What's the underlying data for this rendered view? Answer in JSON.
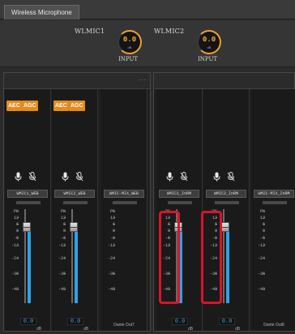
{
  "tabs": [
    {
      "label": "Wireless Microphone"
    }
  ],
  "inputs": [
    {
      "name": "WLMIC1",
      "value": "0.0",
      "unit": "dB",
      "label": "INPUT"
    },
    {
      "name": "WLMIC2",
      "value": "0.0",
      "unit": "dB",
      "label": "INPUT"
    }
  ],
  "menu_dots": "...",
  "aec_label": "AEC",
  "agc_label": "AGC",
  "scale_ticks": [
    "PK",
    "12",
    "6",
    "0",
    "-6",
    "-12",
    "-24",
    "-36",
    "-48"
  ],
  "db_unit": "dB",
  "channels": [
    {
      "name": "WMIC1_WEB",
      "value": "0.0",
      "has_buttons": true,
      "has_icons": true,
      "has_fader": true,
      "output": ""
    },
    {
      "name": "WMIC2_WEB",
      "value": "0.0",
      "has_buttons": true,
      "has_icons": true,
      "has_fader": true,
      "output": ""
    },
    {
      "name": "WMIC-MIX_WEB",
      "value": "",
      "has_buttons": false,
      "has_icons": false,
      "has_fader": false,
      "output": "Dante Out7"
    },
    {
      "name": "WMIC1_InRM",
      "value": "0.0",
      "has_buttons": false,
      "has_icons": true,
      "has_fader": true,
      "output": ""
    },
    {
      "name": "WMIC2_InRM",
      "value": "0.0",
      "has_buttons": false,
      "has_icons": true,
      "has_fader": true,
      "output": ""
    },
    {
      "name": "WMIC-MIX_InRM",
      "value": "",
      "has_buttons": false,
      "has_icons": false,
      "has_fader": false,
      "output": "Dante Out8"
    }
  ],
  "colors": {
    "accent": "#e58b1d",
    "meter": "#2ea3e6",
    "highlight": "#d9142b",
    "knob_value": "#ffb030"
  },
  "icons": {
    "mic": "microphone-icon",
    "mute": "microphone-off-icon"
  }
}
